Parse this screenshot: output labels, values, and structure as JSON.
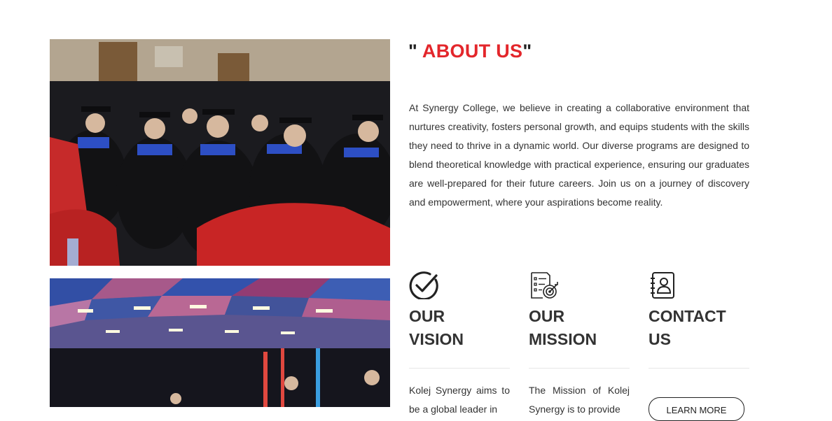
{
  "about": {
    "quote_open": "\"",
    "title": "ABOUT US",
    "quote_close": "\"",
    "title_color": "#e3262b",
    "paragraph": "At Synergy College, we believe in creating a collaborative environment that nurtures creativity, fosters personal growth, and equips students with the skills they need to thrive in a dynamic world. Our diverse programs are designed to blend theoretical knowledge with practical experience, ensuring our graduates are well-prepared for their future careers. Join us on a journey of discovery and empowerment, where your aspirations become reality."
  },
  "cards": {
    "vision": {
      "icon": "check-circle-icon",
      "title_line1": "OUR",
      "title_line2": "VISION",
      "text": "Kolej Synergy aims to be a global leader in"
    },
    "mission": {
      "icon": "checklist-target-icon",
      "title_line1": "OUR",
      "title_line2": "MISSION",
      "text": "The Mission of Kolej Synergy is to provide"
    },
    "contact": {
      "icon": "contact-book-icon",
      "title_line1": "CONTACT",
      "title_line2": "US",
      "button_label": "LEARN MORE"
    }
  }
}
